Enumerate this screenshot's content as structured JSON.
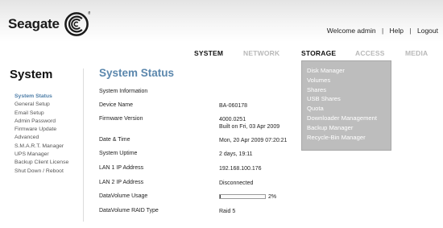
{
  "header": {
    "brand": "Seagate",
    "registered": "®",
    "welcome": "Welcome admin",
    "help": "Help",
    "logout": "Logout",
    "separator": "|"
  },
  "nav": {
    "tabs": [
      {
        "label": "SYSTEM",
        "state": "active"
      },
      {
        "label": "NETWORK",
        "state": "dim"
      },
      {
        "label": "STORAGE",
        "state": "hover"
      },
      {
        "label": "ACCESS",
        "state": "dim"
      },
      {
        "label": "MEDIA",
        "state": "dim"
      }
    ]
  },
  "sidebar": {
    "title": "System",
    "items": [
      {
        "label": "System Status",
        "active": true
      },
      {
        "label": "General Setup"
      },
      {
        "label": "Email Setup"
      },
      {
        "label": "Admin Password"
      },
      {
        "label": "Firmware Update"
      },
      {
        "label": "Advanced"
      },
      {
        "label": "S.M.A.R.T. Manager"
      },
      {
        "label": "UPS Manager"
      },
      {
        "label": "Backup Client License"
      },
      {
        "label": "Shut Down / Reboot"
      }
    ]
  },
  "main": {
    "title": "System Status",
    "section": "System Information",
    "rows": [
      {
        "label": "Device Name",
        "value": "BA-060178"
      },
      {
        "label": "Firmware Version",
        "value": "4000.0251",
        "value2": "Built on Fri, 03 Apr 2009"
      },
      {
        "label": "Date & Time",
        "value": "Mon, 20 Apr 2009 07:20:21"
      },
      {
        "label": "System Uptime",
        "value": "2 days, 19:11"
      },
      {
        "label": "LAN 1 IP Address",
        "value": "192.168.100.176"
      },
      {
        "label": "LAN 2 IP Address",
        "value": "Disconnected"
      },
      {
        "label": "DataVolume Usage",
        "percent_text": "2%",
        "fraction": 0.02
      },
      {
        "label": "DataVolume RAID Type",
        "value": "Raid 5"
      }
    ]
  },
  "storage_menu": {
    "items": [
      "Disk Manager",
      "Volumes",
      "Shares",
      "USB Shares",
      "Quota",
      "Downloader Management",
      "Backup Manager",
      "Recycle-Bin Manager"
    ]
  },
  "colors": {
    "accent": "#5b87ad",
    "menu_bg": "#bdbdbd",
    "active_sidebar": "#4e7ea8"
  }
}
